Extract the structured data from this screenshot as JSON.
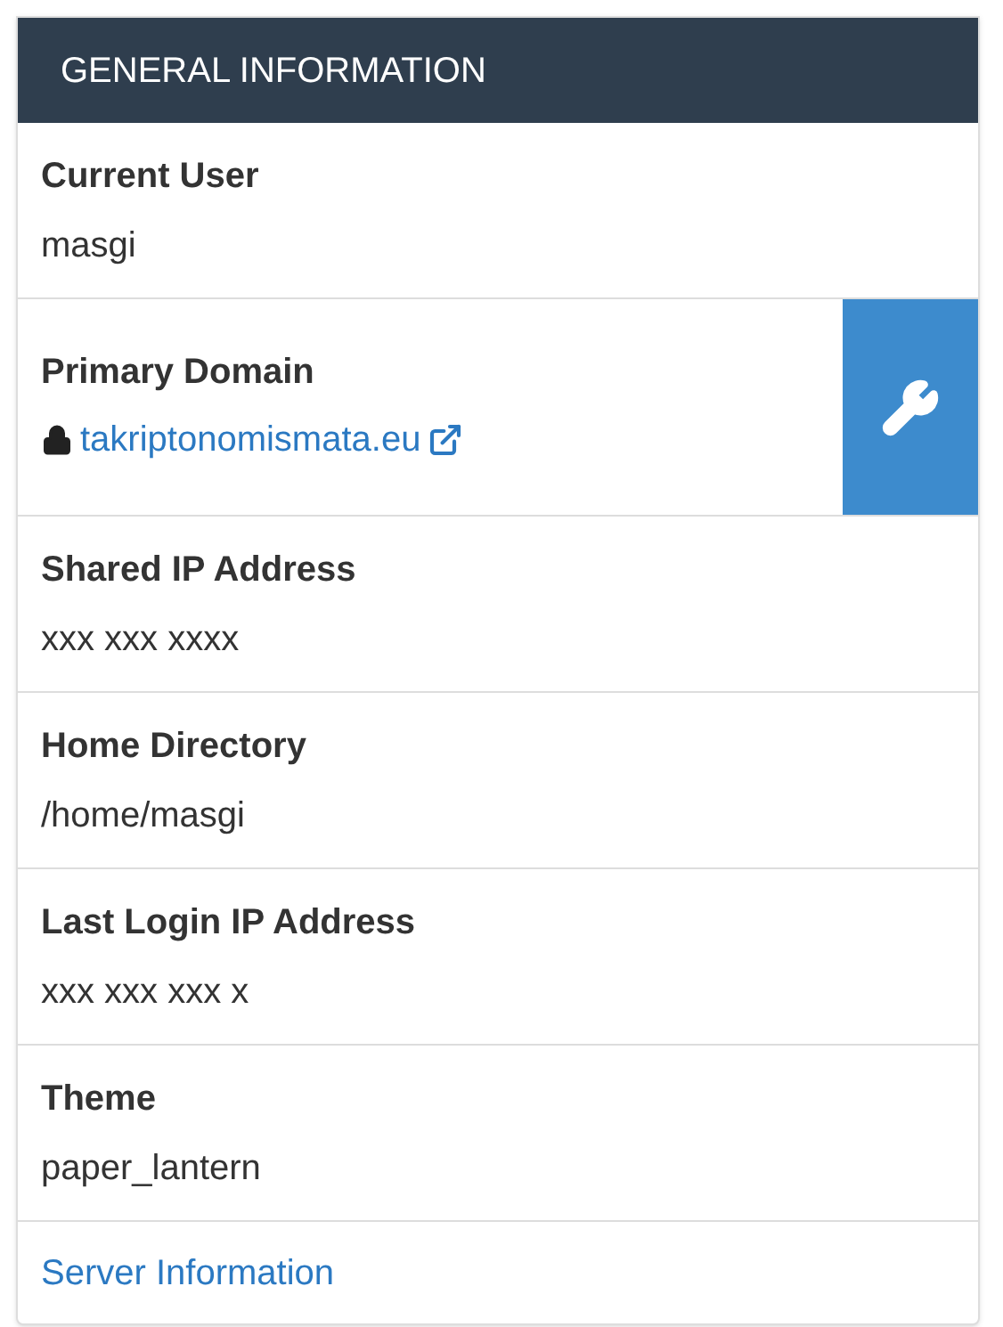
{
  "panel": {
    "title": "GENERAL INFORMATION",
    "items": [
      {
        "kind": "text",
        "label": "Current User",
        "value": "masgi"
      },
      {
        "kind": "domain",
        "label": "Primary Domain",
        "value": "takriptonomismata.eu",
        "secure": true
      },
      {
        "kind": "text",
        "label": "Shared IP Address",
        "value": "xxx xxx xxxx"
      },
      {
        "kind": "text",
        "label": "Home Directory",
        "value": "/home/masgi"
      },
      {
        "kind": "text",
        "label": "Last Login IP Address",
        "value": "xxx xxx xxx x"
      },
      {
        "kind": "text",
        "label": "Theme",
        "value": "paper_lantern"
      }
    ],
    "footer_link": "Server Information"
  }
}
